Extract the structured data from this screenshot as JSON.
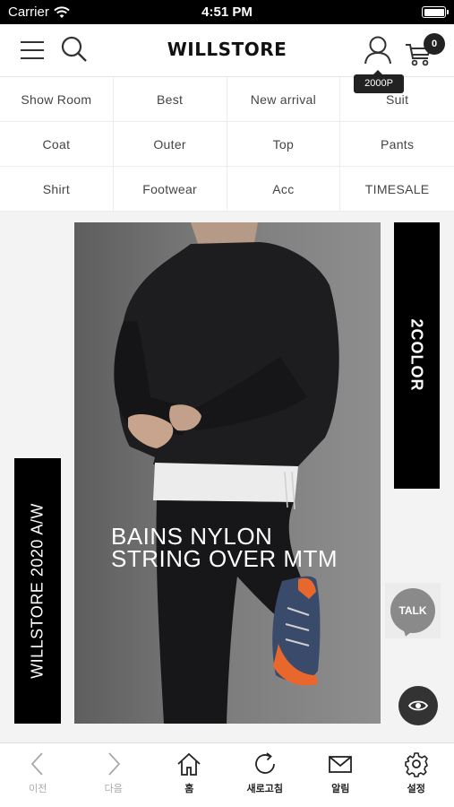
{
  "status_bar": {
    "carrier": "Carrier",
    "time": "4:51 PM"
  },
  "header": {
    "logo": "WILLSTORE",
    "cart_count": "0",
    "points_tooltip": "2000P",
    "icons": [
      "menu-icon",
      "search-icon",
      "user-icon",
      "cart-icon"
    ]
  },
  "categories": [
    "Show Room",
    "Best",
    "New arrival",
    "Suit",
    "Coat",
    "Outer",
    "Top",
    "Pants",
    "Shirt",
    "Footwear",
    "Acc",
    "TIMESALE"
  ],
  "banner": {
    "title_line1": "BAINS NYLON",
    "title_line2": "STRING OVER MTM",
    "side_tag_right": "2COLOR",
    "side_tag_left": "WILLSTORE 2020 A/W"
  },
  "floating": {
    "talk_label": "TALK",
    "icons": [
      "talk-bubble-icon",
      "eye-icon"
    ]
  },
  "toolbar": {
    "items": [
      {
        "label": "이전",
        "icon": "chevron-left-icon",
        "enabled": false
      },
      {
        "label": "다음",
        "icon": "chevron-right-icon",
        "enabled": false
      },
      {
        "label": "홈",
        "icon": "home-icon",
        "enabled": true
      },
      {
        "label": "새로고침",
        "icon": "refresh-icon",
        "enabled": true
      },
      {
        "label": "알림",
        "icon": "mail-icon",
        "enabled": true
      },
      {
        "label": "설정",
        "icon": "gear-icon",
        "enabled": true
      }
    ]
  },
  "colors": {
    "accent": "#000000",
    "background": "#f3f3f3",
    "disabled": "#aaaaaa"
  }
}
